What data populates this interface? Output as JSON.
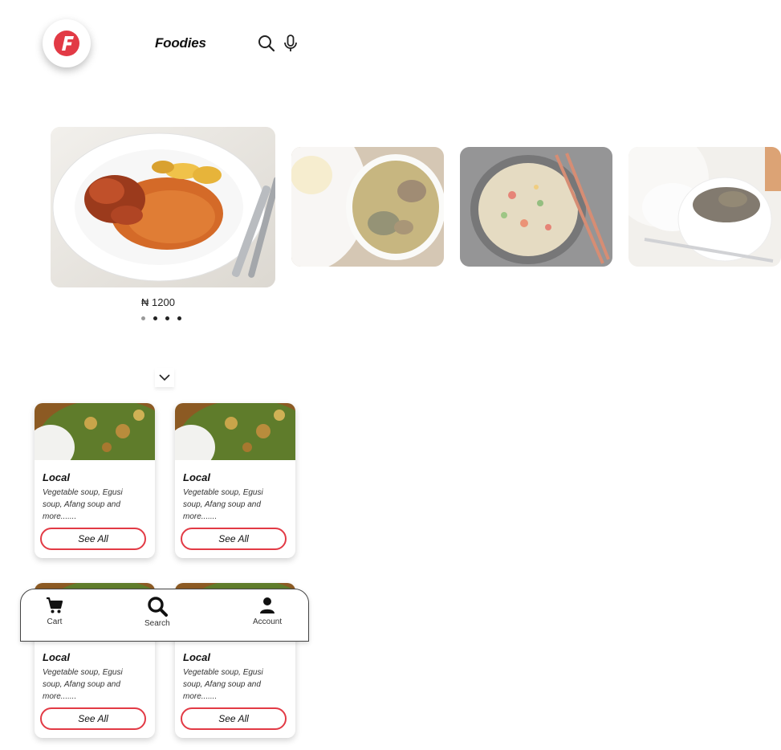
{
  "app": {
    "brand_name": "Foodies",
    "logo_letter": "F",
    "accent_color": "#e23a45"
  },
  "header": {
    "icons": [
      "search-icon",
      "microphone-icon"
    ]
  },
  "carousel": {
    "featured_price": "₦ 1200",
    "dot_count": 4,
    "active_dot": 0,
    "slides": [
      "jollof-rice-chicken-plantain",
      "soup-with-fufu",
      "fried-rice",
      "fufu-with-soup"
    ]
  },
  "expand": {
    "icon": "chevron-down-icon"
  },
  "cards": [
    {
      "title": "Local",
      "description": "Vegetable soup, Egusi soup, Afang soup and more.......",
      "button": "See All"
    },
    {
      "title": "Local",
      "description": "Vegetable soup, Egusi soup, Afang soup and more.......",
      "button": "See All"
    },
    {
      "title": "Local",
      "description": "Vegetable soup, Egusi soup, Afang soup and more.......",
      "button": "See All"
    },
    {
      "title": "Local",
      "description": "Vegetable soup, Egusi soup, Afang soup and more.......",
      "button": "See All"
    }
  ],
  "bottom_nav": {
    "items": [
      {
        "label": "Cart",
        "icon": "cart-icon"
      },
      {
        "label": "Search",
        "icon": "search-icon"
      },
      {
        "label": "Account",
        "icon": "user-icon"
      }
    ]
  }
}
